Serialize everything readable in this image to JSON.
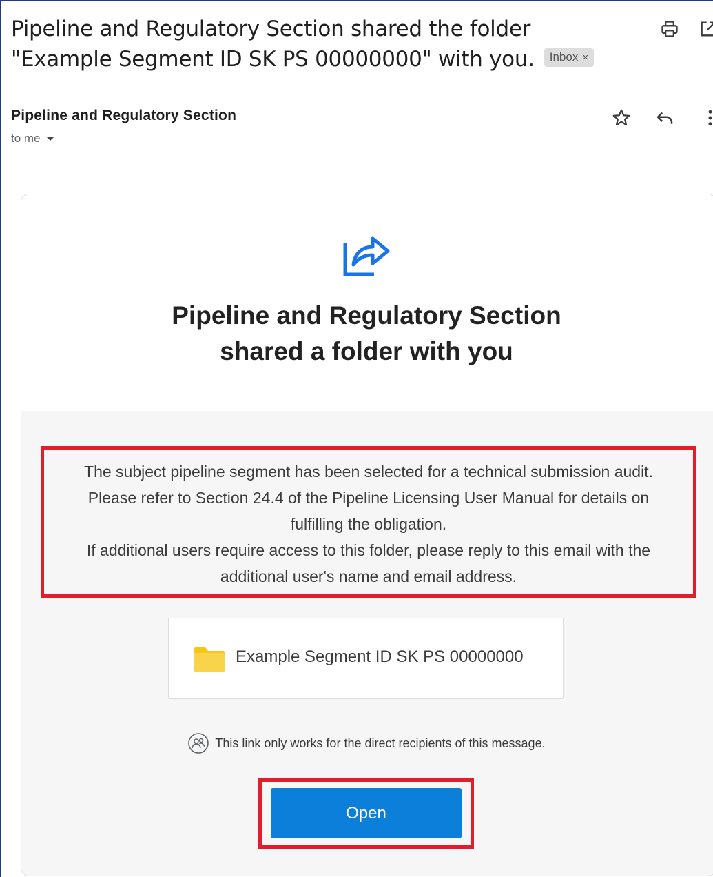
{
  "email": {
    "subject_line_1": "Pipeline and Regulatory Section shared the folder",
    "subject_line_2": "\"Example Segment ID SK PS 00000000\" with you.",
    "label_chip": "Inbox",
    "label_chip_close": "×",
    "sender_name": "Pipeline and Regulatory Section",
    "recipient": "to me"
  },
  "card": {
    "headline_line_1": "Pipeline and Regulatory Section",
    "headline_line_2": "shared a folder with you",
    "notice_line_1": "The subject pipeline segment has been selected for a technical submission audit.",
    "notice_line_2": "Please refer to Section 24.4 of the Pipeline Licensing User Manual for details on",
    "notice_line_3": "fulfilling the obligation.",
    "notice_line_4": "If additional users require access to this folder, please reply to this email with the",
    "notice_line_5": "additional user's name and email address.",
    "folder_name": "Example Segment ID SK PS 00000000",
    "link_note": "This link only works for the direct recipients of this message.",
    "open_button_label": "Open"
  },
  "colors": {
    "highlight_red": "#e21d2d",
    "button_blue": "#0b7fd9",
    "folder_yellow": "#f5c518",
    "share_icon_blue": "#1a73e8"
  },
  "icons": [
    "print-icon",
    "open-in-new-window-icon",
    "star-icon",
    "reply-icon",
    "more-vert-icon",
    "share-arrow-icon",
    "folder-icon",
    "people-icon",
    "chevron-down-icon"
  ]
}
